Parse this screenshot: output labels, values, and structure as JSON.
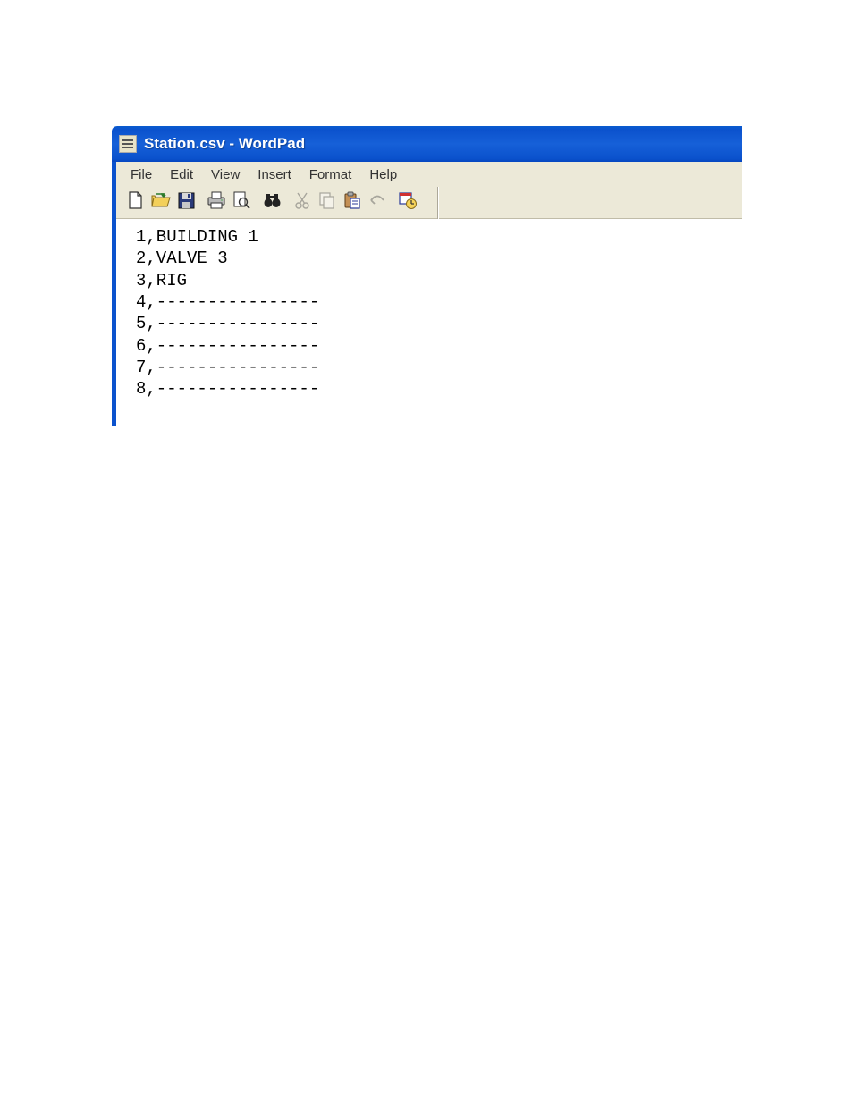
{
  "titlebar": {
    "text": "Station.csv - WordPad"
  },
  "menubar": {
    "items": [
      "File",
      "Edit",
      "View",
      "Insert",
      "Format",
      "Help"
    ]
  },
  "toolbar": {
    "new": "New",
    "open": "Open",
    "save": "Save",
    "print": "Print",
    "print_preview": "Print Preview",
    "find": "Find",
    "cut": "Cut",
    "copy": "Copy",
    "paste": "Paste",
    "undo": "Undo",
    "datetime": "Date/Time"
  },
  "content": {
    "text": "1,BUILDING 1\n2,VALVE 3\n3,RIG\n4,----------------\n5,----------------\n6,----------------\n7,----------------\n8,----------------"
  }
}
